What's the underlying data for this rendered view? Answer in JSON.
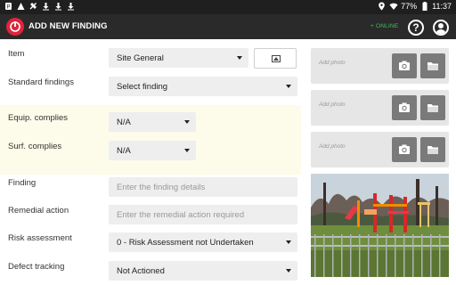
{
  "statusbar": {
    "battery": "77%",
    "time": "11:37"
  },
  "header": {
    "title": "ADD NEW FINDING",
    "status": "+ ONLINE",
    "help_label": "?"
  },
  "form": {
    "item": {
      "label": "Item",
      "value": "Site General"
    },
    "standard_findings": {
      "label": "Standard findings",
      "value": "Select finding"
    },
    "equip_complies": {
      "label": "Equip. complies",
      "value": "N/A"
    },
    "surf_complies": {
      "label": "Surf. complies",
      "value": "N/A"
    },
    "finding": {
      "label": "Finding",
      "placeholder": "Enter the finding details"
    },
    "remedial_action": {
      "label": "Remedial action",
      "placeholder": "Enter the remedial action required"
    },
    "risk_assessment": {
      "label": "Risk assessment",
      "value": "0 - Risk Assessment not Undertaken"
    },
    "defect_tracking": {
      "label": "Defect tracking",
      "value": "Not Actioned"
    }
  },
  "photos": {
    "add_label": "Add photo",
    "slots": 3
  },
  "colors": {
    "appbar": "#2a2a2a",
    "logo": "#e0243b",
    "online": "#3fc15a",
    "highlight": "#fdfbe9"
  }
}
